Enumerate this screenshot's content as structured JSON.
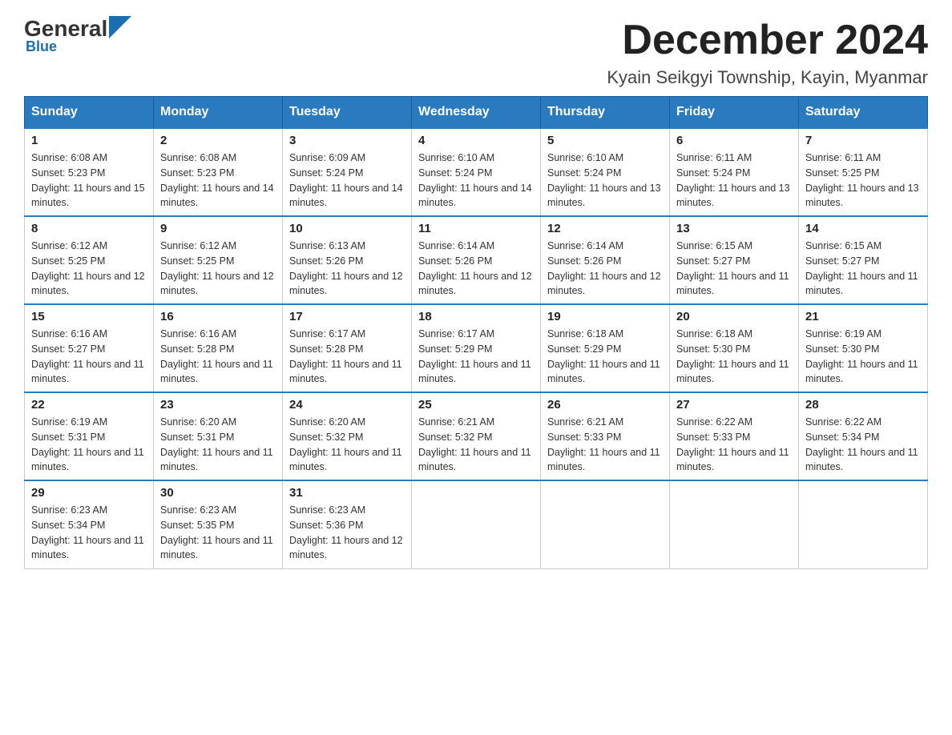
{
  "logo": {
    "general": "General",
    "blue": "Blue"
  },
  "title": "December 2024",
  "subtitle": "Kyain Seikgyi Township, Kayin, Myanmar",
  "days_of_week": [
    "Sunday",
    "Monday",
    "Tuesday",
    "Wednesday",
    "Thursday",
    "Friday",
    "Saturday"
  ],
  "weeks": [
    [
      {
        "day": "1",
        "sunrise": "6:08 AM",
        "sunset": "5:23 PM",
        "daylight": "11 hours and 15 minutes."
      },
      {
        "day": "2",
        "sunrise": "6:08 AM",
        "sunset": "5:23 PM",
        "daylight": "11 hours and 14 minutes."
      },
      {
        "day": "3",
        "sunrise": "6:09 AM",
        "sunset": "5:24 PM",
        "daylight": "11 hours and 14 minutes."
      },
      {
        "day": "4",
        "sunrise": "6:10 AM",
        "sunset": "5:24 PM",
        "daylight": "11 hours and 14 minutes."
      },
      {
        "day": "5",
        "sunrise": "6:10 AM",
        "sunset": "5:24 PM",
        "daylight": "11 hours and 13 minutes."
      },
      {
        "day": "6",
        "sunrise": "6:11 AM",
        "sunset": "5:24 PM",
        "daylight": "11 hours and 13 minutes."
      },
      {
        "day": "7",
        "sunrise": "6:11 AM",
        "sunset": "5:25 PM",
        "daylight": "11 hours and 13 minutes."
      }
    ],
    [
      {
        "day": "8",
        "sunrise": "6:12 AM",
        "sunset": "5:25 PM",
        "daylight": "11 hours and 12 minutes."
      },
      {
        "day": "9",
        "sunrise": "6:12 AM",
        "sunset": "5:25 PM",
        "daylight": "11 hours and 12 minutes."
      },
      {
        "day": "10",
        "sunrise": "6:13 AM",
        "sunset": "5:26 PM",
        "daylight": "11 hours and 12 minutes."
      },
      {
        "day": "11",
        "sunrise": "6:14 AM",
        "sunset": "5:26 PM",
        "daylight": "11 hours and 12 minutes."
      },
      {
        "day": "12",
        "sunrise": "6:14 AM",
        "sunset": "5:26 PM",
        "daylight": "11 hours and 12 minutes."
      },
      {
        "day": "13",
        "sunrise": "6:15 AM",
        "sunset": "5:27 PM",
        "daylight": "11 hours and 11 minutes."
      },
      {
        "day": "14",
        "sunrise": "6:15 AM",
        "sunset": "5:27 PM",
        "daylight": "11 hours and 11 minutes."
      }
    ],
    [
      {
        "day": "15",
        "sunrise": "6:16 AM",
        "sunset": "5:27 PM",
        "daylight": "11 hours and 11 minutes."
      },
      {
        "day": "16",
        "sunrise": "6:16 AM",
        "sunset": "5:28 PM",
        "daylight": "11 hours and 11 minutes."
      },
      {
        "day": "17",
        "sunrise": "6:17 AM",
        "sunset": "5:28 PM",
        "daylight": "11 hours and 11 minutes."
      },
      {
        "day": "18",
        "sunrise": "6:17 AM",
        "sunset": "5:29 PM",
        "daylight": "11 hours and 11 minutes."
      },
      {
        "day": "19",
        "sunrise": "6:18 AM",
        "sunset": "5:29 PM",
        "daylight": "11 hours and 11 minutes."
      },
      {
        "day": "20",
        "sunrise": "6:18 AM",
        "sunset": "5:30 PM",
        "daylight": "11 hours and 11 minutes."
      },
      {
        "day": "21",
        "sunrise": "6:19 AM",
        "sunset": "5:30 PM",
        "daylight": "11 hours and 11 minutes."
      }
    ],
    [
      {
        "day": "22",
        "sunrise": "6:19 AM",
        "sunset": "5:31 PM",
        "daylight": "11 hours and 11 minutes."
      },
      {
        "day": "23",
        "sunrise": "6:20 AM",
        "sunset": "5:31 PM",
        "daylight": "11 hours and 11 minutes."
      },
      {
        "day": "24",
        "sunrise": "6:20 AM",
        "sunset": "5:32 PM",
        "daylight": "11 hours and 11 minutes."
      },
      {
        "day": "25",
        "sunrise": "6:21 AM",
        "sunset": "5:32 PM",
        "daylight": "11 hours and 11 minutes."
      },
      {
        "day": "26",
        "sunrise": "6:21 AM",
        "sunset": "5:33 PM",
        "daylight": "11 hours and 11 minutes."
      },
      {
        "day": "27",
        "sunrise": "6:22 AM",
        "sunset": "5:33 PM",
        "daylight": "11 hours and 11 minutes."
      },
      {
        "day": "28",
        "sunrise": "6:22 AM",
        "sunset": "5:34 PM",
        "daylight": "11 hours and 11 minutes."
      }
    ],
    [
      {
        "day": "29",
        "sunrise": "6:23 AM",
        "sunset": "5:34 PM",
        "daylight": "11 hours and 11 minutes."
      },
      {
        "day": "30",
        "sunrise": "6:23 AM",
        "sunset": "5:35 PM",
        "daylight": "11 hours and 11 minutes."
      },
      {
        "day": "31",
        "sunrise": "6:23 AM",
        "sunset": "5:36 PM",
        "daylight": "11 hours and 12 minutes."
      },
      null,
      null,
      null,
      null
    ]
  ]
}
